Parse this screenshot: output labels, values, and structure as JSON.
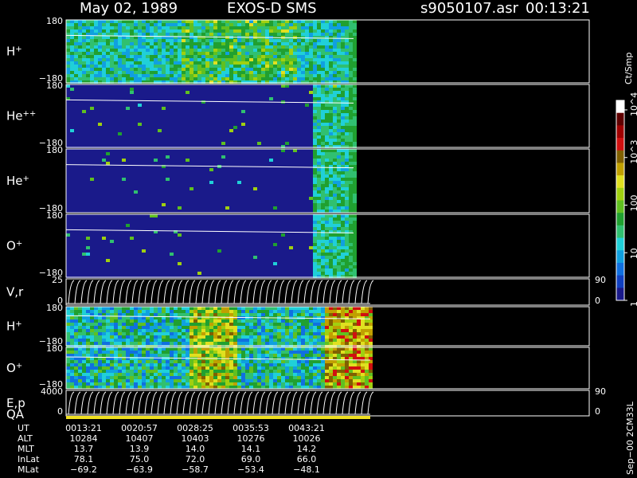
{
  "header": {
    "date": "May 02, 1989",
    "instrument": "EXOS-D SMS",
    "file": "s9050107.asr",
    "time": "00:13:21"
  },
  "colorbar": {
    "unit": "Ct/Smp",
    "ticks": [
      {
        "label": "1",
        "value": 1
      },
      {
        "label": "10",
        "value": 10
      },
      {
        "label": "100",
        "value": 100
      },
      {
        "label": "10^3",
        "value": 1000
      },
      {
        "label": "10^4",
        "value": 10000
      }
    ],
    "colors": [
      "#1a1a8a",
      "#1040c0",
      "#1070e0",
      "#10a0e0",
      "#20d0d8",
      "#30c070",
      "#20a030",
      "#60c020",
      "#a0d010",
      "#e0e020",
      "#c0a000",
      "#806000",
      "#d01010",
      "#a00000",
      "#600000",
      "#ffffff"
    ]
  },
  "chart_data": {
    "type": "heatmap",
    "panels": [
      {
        "name": "H",
        "charge": "+",
        "kind": "spectrogram",
        "ymax": "180",
        "ymin": "−180",
        "data_end_fraction": 0.945
      },
      {
        "name": "He",
        "charge": "++",
        "kind": "spectrogram",
        "ymax": "180",
        "ymin": "−180",
        "data_end_fraction": 0.945
      },
      {
        "name": "He",
        "charge": "+",
        "kind": "spectrogram",
        "ymax": "180",
        "ymin": "−180",
        "data_end_fraction": 0.945
      },
      {
        "name": "O",
        "charge": "+",
        "kind": "spectrogram",
        "ymax": "180",
        "ymin": "−180",
        "data_end_fraction": 0.945
      },
      {
        "name": "V,r",
        "charge": "",
        "kind": "trace",
        "ymax": "25",
        "ymin": "0",
        "right_top": "90",
        "right_bottom": "0"
      },
      {
        "name": "H",
        "charge": "+",
        "kind": "spectrogram",
        "ymax": "180",
        "ymin": "−180",
        "data_end_fraction": 1.0
      },
      {
        "name": "O",
        "charge": "+",
        "kind": "spectrogram",
        "ymax": "180",
        "ymin": "−180",
        "data_end_fraction": 1.0
      },
      {
        "name": "E,p",
        "charge": "",
        "kind": "trace",
        "ymax": "4000",
        "ymin": "0",
        "right_top": "90",
        "right_bottom": "0"
      }
    ],
    "qa_label": "QA",
    "x_table": {
      "rows": [
        {
          "label": "UT",
          "values": [
            "0013:21",
            "0020:57",
            "0028:25",
            "0035:53",
            "0043:21"
          ]
        },
        {
          "label": "ALT",
          "values": [
            "10284",
            "10407",
            "10403",
            "10276",
            "10026"
          ]
        },
        {
          "label": "MLT",
          "values": [
            "13.7",
            "13.9",
            "14.0",
            "14.1",
            "14.2"
          ]
        },
        {
          "label": "InLat",
          "values": [
            "78.1",
            "75.0",
            "72.0",
            "69.0",
            "66.0"
          ]
        },
        {
          "label": "MLat",
          "values": [
            "−69.2",
            "−63.9",
            "−58.7",
            "−53.4",
            "−48.1"
          ]
        }
      ]
    }
  },
  "footer": {
    "side_note": "Sep−00  2CM33L"
  }
}
